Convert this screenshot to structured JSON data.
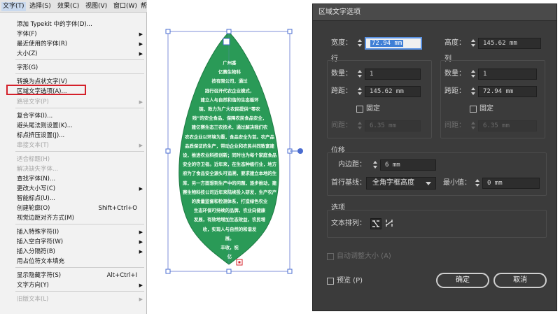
{
  "menubar": {
    "items": [
      "文字(T)",
      "选择(S)",
      "效果(C)",
      "视图(V)",
      "窗口(W)",
      "帮"
    ]
  },
  "menu": {
    "items": [
      {
        "label": "添加 Typekit 中的字体(D)...",
        "shortcut": "",
        "submenu": false,
        "disabled": false
      },
      {
        "label": "字体(F)",
        "shortcut": "",
        "submenu": true,
        "disabled": false
      },
      {
        "label": "最近使用的字体(R)",
        "shortcut": "",
        "submenu": true,
        "disabled": false
      },
      {
        "label": "大小(Z)",
        "shortcut": "",
        "submenu": true,
        "disabled": false
      },
      {
        "label": "字形(G)",
        "shortcut": "",
        "submenu": false,
        "disabled": false
      },
      {
        "label": "转换为点状文字(V)",
        "shortcut": "",
        "submenu": false,
        "disabled": false
      },
      {
        "label": "区域文字选项(A)...",
        "shortcut": "",
        "submenu": false,
        "disabled": false
      },
      {
        "label": "路径文字(P)",
        "shortcut": "",
        "submenu": true,
        "disabled": true
      },
      {
        "label": "复合字体(I)...",
        "shortcut": "",
        "submenu": false,
        "disabled": false
      },
      {
        "label": "避头尾法则设置(K)...",
        "shortcut": "",
        "submenu": false,
        "disabled": false
      },
      {
        "label": "标点挤压设置(J)...",
        "shortcut": "",
        "submenu": false,
        "disabled": false
      },
      {
        "label": "串接文本(T)",
        "shortcut": "",
        "submenu": true,
        "disabled": true
      },
      {
        "label": "适合标题(H)",
        "shortcut": "",
        "submenu": false,
        "disabled": true
      },
      {
        "label": "解决缺失字体...",
        "shortcut": "",
        "submenu": false,
        "disabled": true
      },
      {
        "label": "查找字体(N)...",
        "shortcut": "",
        "submenu": false,
        "disabled": false
      },
      {
        "label": "更改大小写(C)",
        "shortcut": "",
        "submenu": true,
        "disabled": false
      },
      {
        "label": "智能标点(U)...",
        "shortcut": "",
        "submenu": false,
        "disabled": false
      },
      {
        "label": "创建轮廓(O)",
        "shortcut": "Shift+Ctrl+O",
        "submenu": false,
        "disabled": false
      },
      {
        "label": "视觉边距对齐方式(M)",
        "shortcut": "",
        "submenu": false,
        "disabled": false
      },
      {
        "label": "插入特殊字符(I)",
        "shortcut": "",
        "submenu": true,
        "disabled": false
      },
      {
        "label": "插入空白字符(W)",
        "shortcut": "",
        "submenu": true,
        "disabled": false
      },
      {
        "label": "插入分隔符(B)",
        "shortcut": "",
        "submenu": true,
        "disabled": false
      },
      {
        "label": "用占位符文本填充",
        "shortcut": "",
        "submenu": false,
        "disabled": false
      },
      {
        "label": "显示隐藏字符(S)",
        "shortcut": "Alt+Ctrl+I",
        "submenu": false,
        "disabled": false
      },
      {
        "label": "文字方向(Y)",
        "shortcut": "",
        "submenu": true,
        "disabled": false
      },
      {
        "label": "旧版文本(L)",
        "shortcut": "",
        "submenu": true,
        "disabled": true
      }
    ]
  },
  "leaf": {
    "color": "#2a9a57",
    "lines": [
      "广州番",
      "亿赛生物科",
      "技有限公司，通过",
      "践行召开代农企业模式，",
      "建立人与自然和谐的生态循环",
      "链，致力为广大农民提供“零农",
      "残”的安全食品，保障农民食品安全，",
      "建亿赛生态三农技术，通过解决我们农",
      "农农企业以环境为重，食品安全为首。农产品",
      "品质保证的生产，带动企业和农民共同致富建",
      "设，推进农业科技创新；同时也为每个家庭食品",
      "安全的守卫者。近年来，在生态种植行业，地方政",
      "府为了食品安全源头可追溯，要求建立本地的生态",
      "库，另一方面想到生产中的问题，逐步推动，建亿",
      "赛生物科技公司近年来陆续投入研发，生产农产品",
      "的质量监督和检测体系，打造绿色农业",
      "生态环保可持续的品牌，农业向健康",
      "发展，有效地增加生态效益，农民增",
      "收，实现人与自然的和谐发",
      "展。",
      "丰收，祝",
      "亿"
    ]
  },
  "dialog": {
    "title": "区域文字选项",
    "width_label": "宽度：",
    "width_value": "72.94 mm",
    "height_label": "高度：",
    "height_value": "145.62 mm",
    "rows_label": "行",
    "rows_count_label": "数量：",
    "rows_count_value": "1",
    "rows_span_label": "跨距：",
    "rows_span_value": "145.62 mm",
    "rows_fixed_label": "固定",
    "rows_gutter_label": "间距：",
    "rows_gutter_value": "6.35 mm",
    "cols_label": "列",
    "cols_count_label": "数量：",
    "cols_count_value": "1",
    "cols_span_label": "跨距：",
    "cols_span_value": "72.94 mm",
    "cols_fixed_label": "固定",
    "cols_gutter_label": "间距：",
    "cols_gutter_value": "6.35 mm",
    "offset_label": "位移",
    "inset_label": "内边距：",
    "inset_value": "6 mm",
    "baseline_label": "首行基线：",
    "baseline_value": "全角字框高度",
    "min_label": "最小值：",
    "min_value": "0 mm",
    "options_label": "选项",
    "text_flow_label": "文本排列：",
    "auto_size_label": "自动调整大小 (A)",
    "preview_label": "预览 (P)",
    "ok_label": "确定",
    "cancel_label": "取消"
  }
}
